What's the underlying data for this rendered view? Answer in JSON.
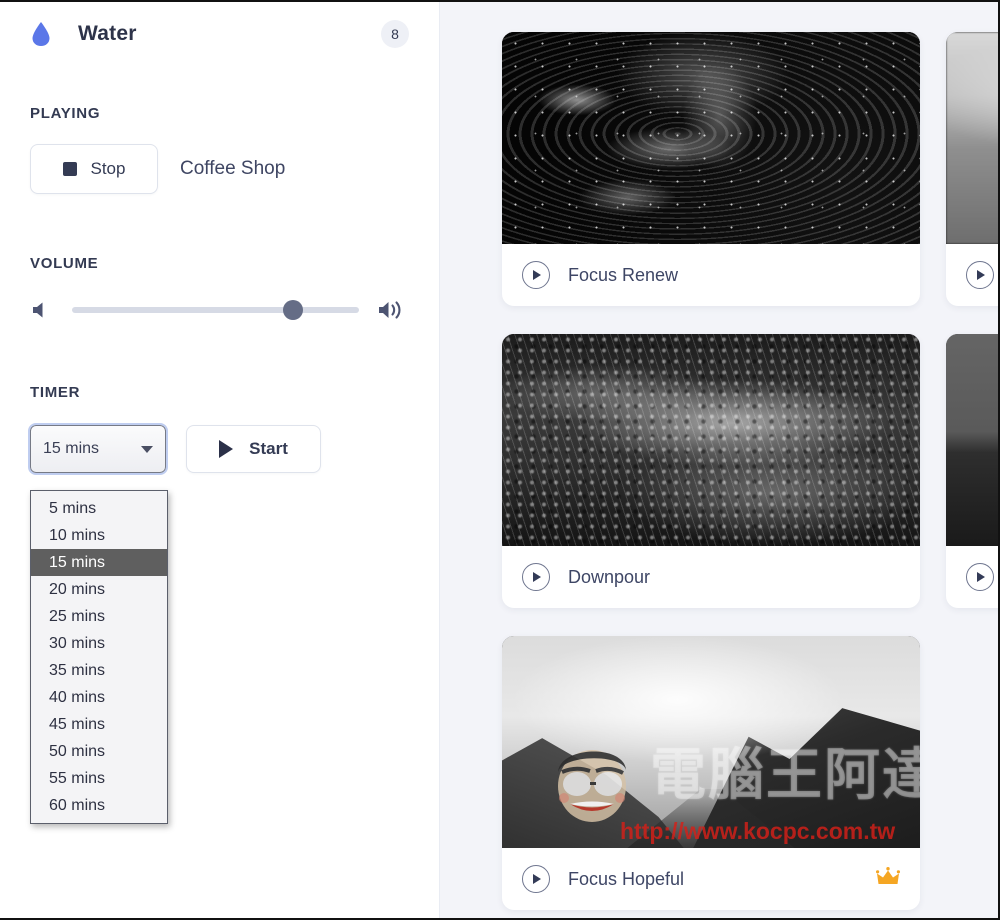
{
  "sidebar": {
    "icon": "water-drop-icon",
    "title": "Water",
    "badge_count": "8",
    "accent_color": "#5b77e8",
    "playing": {
      "label": "PLAYING",
      "stop_button_label": "Stop",
      "track_name": "Coffee Shop"
    },
    "volume": {
      "label": "VOLUME",
      "min_icon": "volume-mute-icon",
      "max_icon": "volume-high-icon",
      "value_percent": 77
    },
    "timer": {
      "label": "TIMER",
      "selected_value": "15 mins",
      "start_button_label": "Start",
      "options": [
        "5 mins",
        "10 mins",
        "15 mins",
        "20 mins",
        "25 mins",
        "30 mins",
        "35 mins",
        "40 mins",
        "45 mins",
        "50 mins",
        "55 mins",
        "60 mins"
      ],
      "highlighted_option": "15 mins",
      "dropdown_open": true
    }
  },
  "content": {
    "background_color": "#f3f4f9",
    "cards_main": [
      {
        "title": "Focus Renew",
        "art": "marble",
        "premium": false,
        "play_icon": "play-icon"
      },
      {
        "title": "Downpour",
        "art": "rain",
        "premium": false,
        "play_icon": "play-icon"
      },
      {
        "title": "Focus Hopeful",
        "art": "mountain",
        "premium": true,
        "play_icon": "play-icon",
        "watermark_cn": "電腦王阿達",
        "watermark_url": "http://www.kocpc.com.tw"
      }
    ],
    "cards_side": [
      {
        "title": "",
        "art": "sky",
        "premium": false,
        "play_icon": "play-icon"
      },
      {
        "title": "",
        "art": "dunes",
        "premium": false,
        "play_icon": "play-icon"
      }
    ],
    "premium_icon": "crown-icon",
    "premium_color": "#f5a623"
  }
}
